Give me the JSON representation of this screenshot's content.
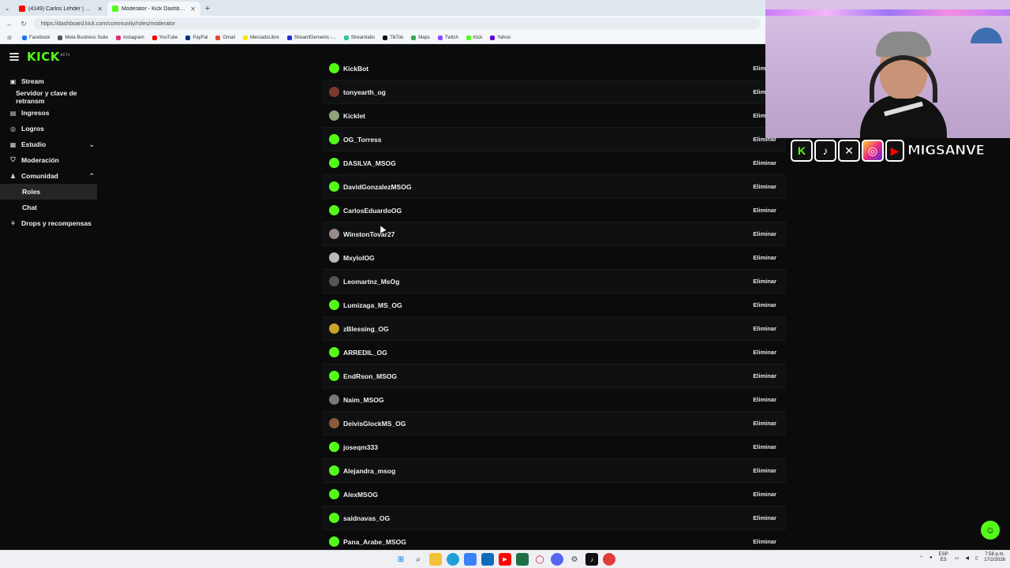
{
  "browser": {
    "tabs": [
      {
        "title": "(4149) Carlos Lehder | CONFESIO",
        "favicon_color": "#ff0000",
        "active": false
      },
      {
        "title": "Moderator - Kick Dashboard",
        "favicon_color": "#53fc18",
        "active": true
      }
    ],
    "new_tab_label": "+",
    "url": "https://dashboard.kick.com/community/roles/moderator",
    "bookmarks": [
      {
        "label": "Facebook",
        "color": "#1877f2"
      },
      {
        "label": "Meta Business Suite",
        "color": "#555555"
      },
      {
        "label": "Instagram",
        "color": "#e1306c"
      },
      {
        "label": "YouTube",
        "color": "#ff0000"
      },
      {
        "label": "PayPal",
        "color": "#003087"
      },
      {
        "label": "Gmail",
        "color": "#ea4335"
      },
      {
        "label": "MercadoLibre",
        "color": "#ffe600"
      },
      {
        "label": "StreamElements -...",
        "color": "#2a2ad8"
      },
      {
        "label": "Streamlabs",
        "color": "#31c3a2"
      },
      {
        "label": "TikTok",
        "color": "#111111"
      },
      {
        "label": "Maps",
        "color": "#34a853"
      },
      {
        "label": "Twitch",
        "color": "#9146ff"
      },
      {
        "label": "Kick",
        "color": "#53fc18"
      },
      {
        "label": "Yahoo",
        "color": "#6001d2"
      }
    ]
  },
  "app": {
    "logo": "KICK",
    "logo_sup": "BETA",
    "accent": "#53fc18"
  },
  "sidebar": {
    "items": [
      {
        "label": "Stream",
        "icon": "stream-icon",
        "glyph": "▣",
        "sub": false,
        "chevron": ""
      },
      {
        "label": "Servidor y clave de retransm",
        "icon": "",
        "glyph": "",
        "sub": false,
        "chevron": ""
      },
      {
        "label": "Ingresos",
        "icon": "income-icon",
        "glyph": "▤",
        "sub": false,
        "chevron": ""
      },
      {
        "label": "Logros",
        "icon": "achievements-icon",
        "glyph": "◎",
        "sub": false,
        "chevron": ""
      },
      {
        "label": "Estudio",
        "icon": "studio-icon",
        "glyph": "▦",
        "sub": false,
        "chevron": "⌄"
      },
      {
        "label": "Moderación",
        "icon": "shield-icon",
        "glyph": "⛉",
        "sub": false,
        "chevron": ""
      },
      {
        "label": "Comunidad",
        "icon": "community-icon",
        "glyph": "♟",
        "sub": false,
        "chevron": "⌃"
      },
      {
        "label": "Roles",
        "icon": "",
        "glyph": "",
        "sub": true,
        "chevron": "",
        "active": true
      },
      {
        "label": "Chat",
        "icon": "",
        "glyph": "",
        "sub": true,
        "chevron": ""
      },
      {
        "label": "Drops y recompensas",
        "icon": "drops-icon",
        "glyph": "⚘",
        "sub": false,
        "chevron": ""
      }
    ]
  },
  "moderators": {
    "remove_label": "Eliminar",
    "rows": [
      {
        "name": "KickBot",
        "avatar_color": "#53fc18"
      },
      {
        "name": "tonyearth_og",
        "avatar_color": "#7a3b2e"
      },
      {
        "name": "Kicklet",
        "avatar_color": "#8fa37c"
      },
      {
        "name": "OG_Torress",
        "avatar_color": "#53fc18"
      },
      {
        "name": "DASILVA_MSOG",
        "avatar_color": "#53fc18"
      },
      {
        "name": "DavidGonzalezMSOG",
        "avatar_color": "#53fc18"
      },
      {
        "name": "CarlosEduardoOG",
        "avatar_color": "#53fc18"
      },
      {
        "name": "WinstonTovar27",
        "avatar_color": "#9a8a8a"
      },
      {
        "name": "MxyloIOG",
        "avatar_color": "#bbbbbb"
      },
      {
        "name": "Leomartnz_MsOg",
        "avatar_color": "#555555"
      },
      {
        "name": "Lumizaga_MS_OG",
        "avatar_color": "#53fc18"
      },
      {
        "name": "zBlessing_OG",
        "avatar_color": "#c9a22a"
      },
      {
        "name": "ARREDIL_OG",
        "avatar_color": "#53fc18"
      },
      {
        "name": "EndRson_MSOG",
        "avatar_color": "#53fc18"
      },
      {
        "name": "Naim_MSOG",
        "avatar_color": "#777777"
      },
      {
        "name": "DeivisGlockMS_OG",
        "avatar_color": "#8b5a3c"
      },
      {
        "name": "joseqm333",
        "avatar_color": "#53fc18"
      },
      {
        "name": "Alejandra_msog",
        "avatar_color": "#53fc18"
      },
      {
        "name": "AlexMSOG",
        "avatar_color": "#53fc18"
      },
      {
        "name": "saidnavas_OG",
        "avatar_color": "#53fc18"
      },
      {
        "name": "Pana_Arabe_MSOG",
        "avatar_color": "#53fc18"
      }
    ]
  },
  "overlay": {
    "handle": "MIGSANVE",
    "socials": [
      {
        "name": "kick-icon",
        "glyph": "K"
      },
      {
        "name": "tiktok-icon",
        "glyph": "♪"
      },
      {
        "name": "x-icon",
        "glyph": "✕"
      },
      {
        "name": "instagram-icon",
        "glyph": "◎"
      },
      {
        "name": "youtube-icon",
        "glyph": "▶"
      }
    ]
  },
  "taskbar": {
    "lang_top": "ESP",
    "lang_bottom": "ES",
    "time": "7:58 p.m.",
    "date": "17/2/2026",
    "tray_chevron": "⌃"
  }
}
